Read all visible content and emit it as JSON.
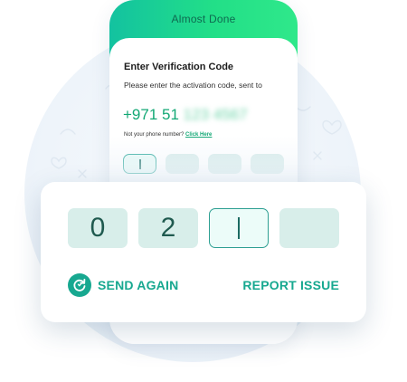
{
  "phone": {
    "title": "Almost Done",
    "heading": "Enter Verification Code",
    "subtext": "Please enter the activation code, sent to",
    "phone_prefix": "+971 51",
    "phone_masked": "123 4567",
    "note_text": "Not your phone number?",
    "note_link": "Click Here"
  },
  "code": {
    "digits": [
      "0",
      "2",
      "",
      ""
    ],
    "active_index": 2
  },
  "actions": {
    "send_again": "SEND AGAIN",
    "report_issue": "REPORT ISSUE"
  },
  "colors": {
    "accent": "#17a890",
    "header_gradient_start": "#13c2a0",
    "header_gradient_end": "#2fe88a",
    "code_box_bg": "#d8eeea"
  },
  "icons": {
    "send_again": "refresh-icon"
  }
}
